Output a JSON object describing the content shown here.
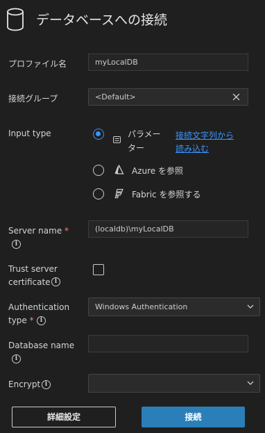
{
  "header": {
    "title": "データベースへの接続",
    "icon": "database-icon"
  },
  "fields": {
    "profile_name": {
      "label": "プロファイル名",
      "value": "myLocalDB"
    },
    "connection_group": {
      "label": "接続グループ",
      "value": "<Default>"
    },
    "input_type": {
      "label": "Input type",
      "options": {
        "parameters": {
          "label_line1": "パラメー",
          "label_line2": "ター",
          "selected": true
        },
        "azure": {
          "label": "Azure を参照"
        },
        "fabric": {
          "label": "Fabric を参照する"
        }
      },
      "link_line1": "接続文字列から",
      "link_line2": "読み込む"
    },
    "server_name": {
      "label": "Server name",
      "required_mark": "*",
      "value": "(localdb)\\myLocalDB"
    },
    "trust_cert": {
      "label_line1": "Trust server",
      "label_line2": "certificate",
      "checked": false
    },
    "authentication": {
      "label_line1": "Authentication",
      "label_line2": "type",
      "required_mark": "*",
      "value": "Windows Authentication"
    },
    "database_name": {
      "label": "Database name",
      "value": ""
    },
    "encrypt": {
      "label": "Encrypt",
      "value": ""
    }
  },
  "buttons": {
    "advanced": "詳細設定",
    "connect": "接続"
  },
  "colors": {
    "accent": "#3794ff",
    "primary_button": "#2a7fb8",
    "background": "#1f1f1f"
  }
}
